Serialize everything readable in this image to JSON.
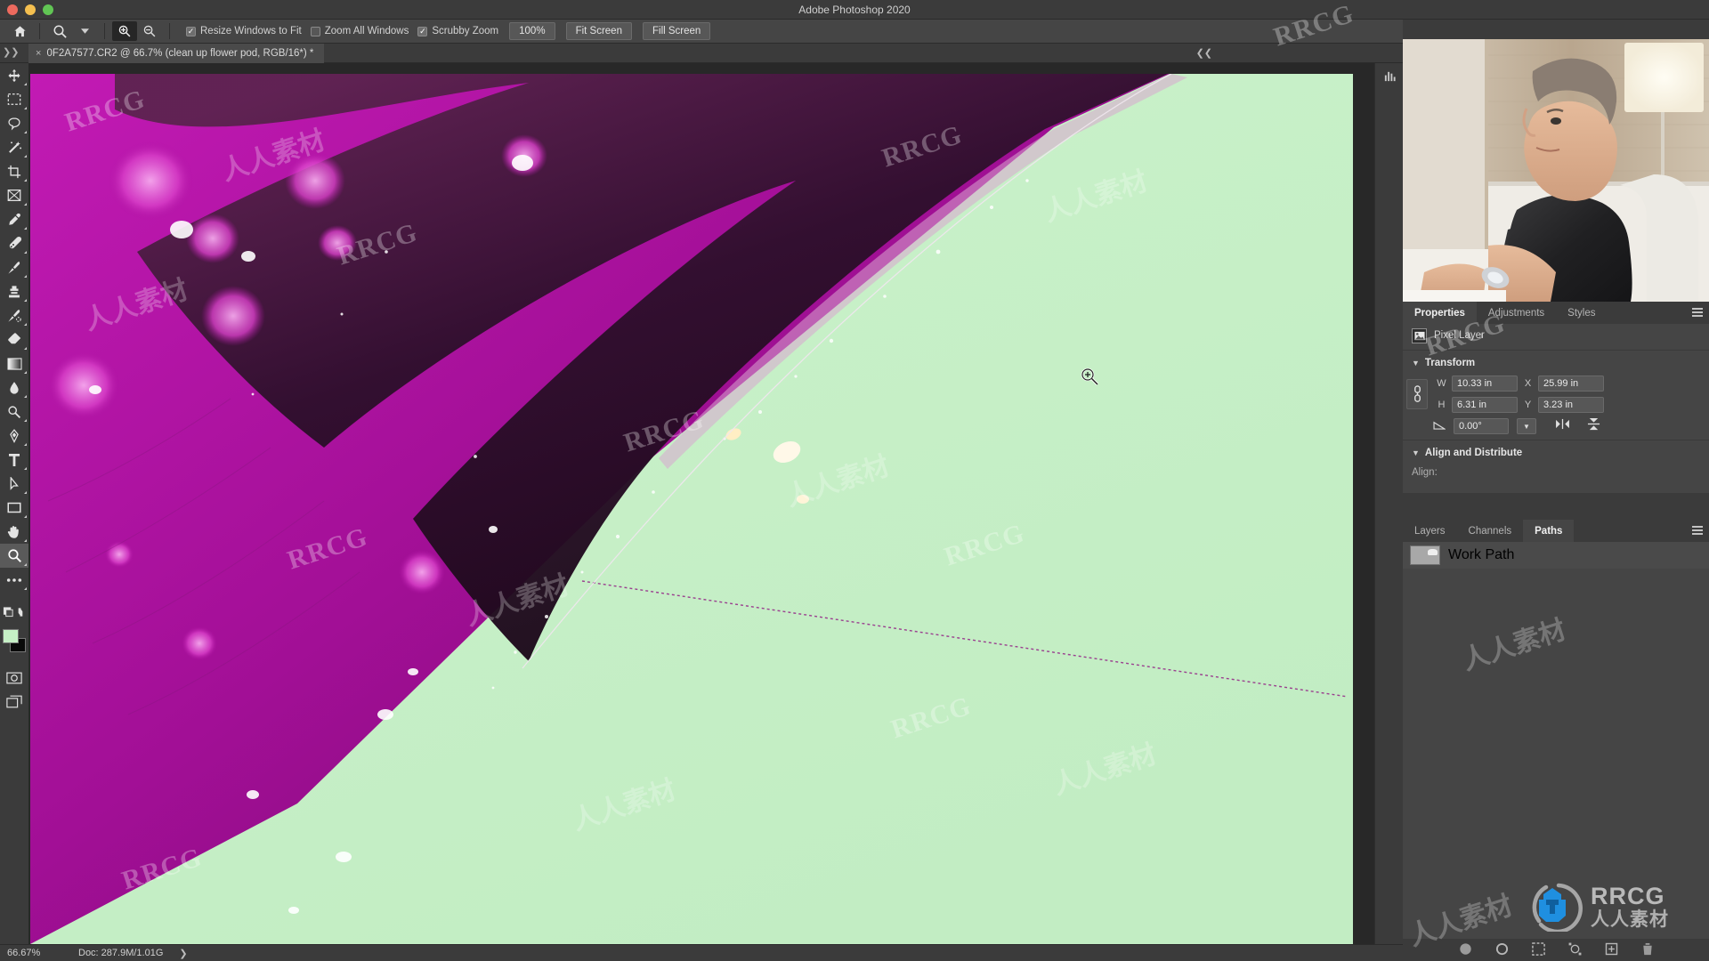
{
  "window": {
    "title": "Adobe Photoshop 2020"
  },
  "options_bar": {
    "home_icon": "home-icon",
    "tool_icon": "zoom-tool-icon",
    "zoom_in_icon": "zoom-in-icon",
    "zoom_out_icon": "zoom-out-icon",
    "checkboxes": [
      {
        "label": "Resize Windows to Fit",
        "checked": true
      },
      {
        "label": "Zoom All Windows",
        "checked": false
      },
      {
        "label": "Scrubby Zoom",
        "checked": true
      }
    ],
    "buttons": [
      {
        "label": "100%"
      },
      {
        "label": "Fit Screen"
      },
      {
        "label": "Fill Screen"
      }
    ]
  },
  "document_tab": {
    "close_glyph": "×",
    "title": "0F2A7577.CR2 @ 66.7% (clean up flower pod, RGB/16*) *"
  },
  "toolbar": {
    "items": [
      {
        "name": "move-tool",
        "icon": "move-icon"
      },
      {
        "name": "rectangular-marquee-tool",
        "icon": "marquee-icon"
      },
      {
        "name": "lasso-tool",
        "icon": "lasso-icon"
      },
      {
        "name": "quick-selection-tool",
        "icon": "magic-wand-icon"
      },
      {
        "name": "crop-tool",
        "icon": "crop-icon"
      },
      {
        "name": "frame-tool",
        "icon": "frame-icon"
      },
      {
        "name": "eyedropper-tool",
        "icon": "eyedropper-icon"
      },
      {
        "name": "spot-healing-brush-tool",
        "icon": "healing-brush-icon"
      },
      {
        "name": "brush-tool",
        "icon": "brush-icon"
      },
      {
        "name": "clone-stamp-tool",
        "icon": "stamp-icon"
      },
      {
        "name": "history-brush-tool",
        "icon": "history-brush-icon"
      },
      {
        "name": "eraser-tool",
        "icon": "eraser-icon"
      },
      {
        "name": "gradient-tool",
        "icon": "gradient-icon"
      },
      {
        "name": "blur-tool",
        "icon": "blur-drop-icon"
      },
      {
        "name": "dodge-tool",
        "icon": "dodge-icon"
      },
      {
        "name": "pen-tool",
        "icon": "pen-icon"
      },
      {
        "name": "type-tool",
        "icon": "type-T-icon"
      },
      {
        "name": "path-selection-tool",
        "icon": "path-arrow-icon"
      },
      {
        "name": "rectangle-tool",
        "icon": "rectangle-icon"
      },
      {
        "name": "hand-tool",
        "icon": "hand-icon"
      },
      {
        "name": "zoom-tool",
        "icon": "magnifier-icon",
        "selected": true
      },
      {
        "name": "edit-toolbar",
        "icon": "ellipsis-icon"
      },
      {
        "name": "default-colors",
        "icon": "default-colors-icon"
      },
      {
        "name": "swap-colors",
        "icon": "swap-colors-icon"
      }
    ],
    "foreground_color": "#c6f0c6",
    "background_color": "#0a0a0a",
    "quick_mask": "quick-mask-icon",
    "screen_mode": "screen-mode-icon"
  },
  "panels": {
    "properties_group": {
      "tabs": [
        {
          "label": "Properties",
          "active": true
        },
        {
          "label": "Adjustments",
          "active": false
        },
        {
          "label": "Styles",
          "active": false
        }
      ],
      "layer_kind": "Pixel Layer",
      "layer_kind_icon": "pixel-layer-icon",
      "transform": {
        "section_label": "Transform",
        "link_icon": "link-wh-icon",
        "fields": [
          {
            "label": "W",
            "value": "10.33 in"
          },
          {
            "label": "X",
            "value": "25.99 in"
          },
          {
            "label": "H",
            "value": "6.31 in"
          },
          {
            "label": "Y",
            "value": "3.23 in"
          }
        ],
        "angle_label": "angle-icon",
        "angle_value": "0.00°",
        "flip_horizontal_icon": "flip-horizontal-icon",
        "flip_vertical_icon": "flip-vertical-icon"
      },
      "align": {
        "section_label": "Align and Distribute",
        "align_label": "Align:"
      }
    },
    "layers_group": {
      "tabs": [
        {
          "label": "Layers",
          "active": false
        },
        {
          "label": "Channels",
          "active": false
        },
        {
          "label": "Paths",
          "active": true
        }
      ],
      "paths": [
        {
          "name": "Work Path",
          "thumbnail": "path-thumbnail"
        }
      ],
      "footer_icons": [
        "fill-path-icon",
        "stroke-path-icon",
        "load-selection-icon",
        "make-work-path-icon",
        "new-path-icon",
        "delete-path-icon"
      ]
    }
  },
  "status_bar": {
    "zoom": "66.67%",
    "doc": "Doc: 287.9M/1.01G",
    "arrow": "❯"
  },
  "canvas": {
    "cursor_icon": "zoom-in-cursor",
    "background_color": "#c8f0c8",
    "petal_color": "#a9129b"
  },
  "branding": {
    "logo_text": "RRCG",
    "logo_subtext": "人人素材",
    "logo_accent": "#1f8fe0",
    "watermark_text": "RRCG",
    "watermark_cn": "人人素材"
  }
}
